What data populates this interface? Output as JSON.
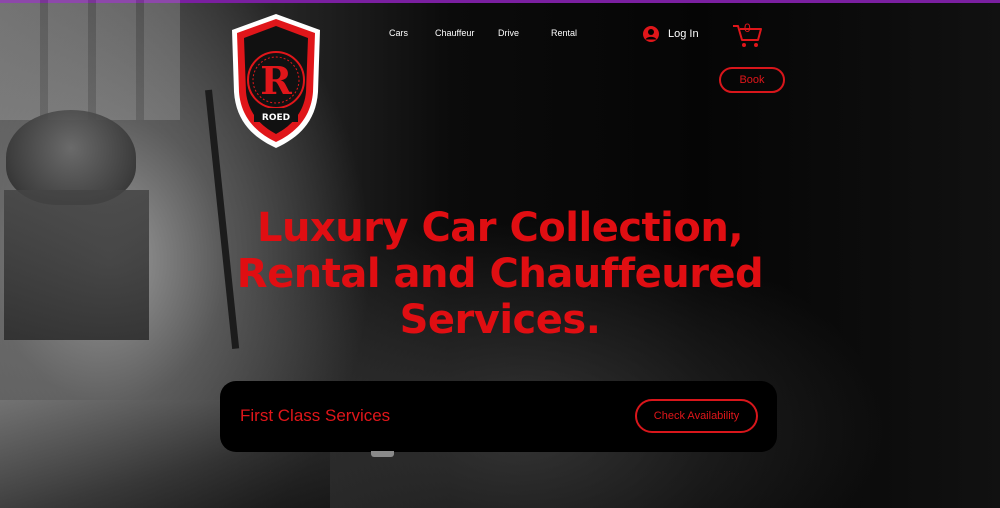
{
  "brand": {
    "logo_text": "ROED",
    "logo_initial": "R"
  },
  "nav": {
    "items": [
      {
        "label": "Cars"
      },
      {
        "label": "Chauffeur"
      },
      {
        "label": "Drive"
      },
      {
        "label": "Rental"
      }
    ]
  },
  "account": {
    "login_label": "Log In"
  },
  "cart": {
    "count": "0"
  },
  "actions": {
    "book_label": "Book"
  },
  "hero": {
    "title_line1": "Luxury Car Collection,",
    "title_line2": "Rental and Chauffeured",
    "title_line3": "Services."
  },
  "cta": {
    "text": "First Class Services",
    "button_label": "Check Availability"
  },
  "colors": {
    "accent": "#e0161a",
    "background": "#000000",
    "top_bar": "#7a1fa0"
  },
  "icons": {
    "login": "user-circle-icon",
    "cart": "shopping-cart-icon"
  }
}
